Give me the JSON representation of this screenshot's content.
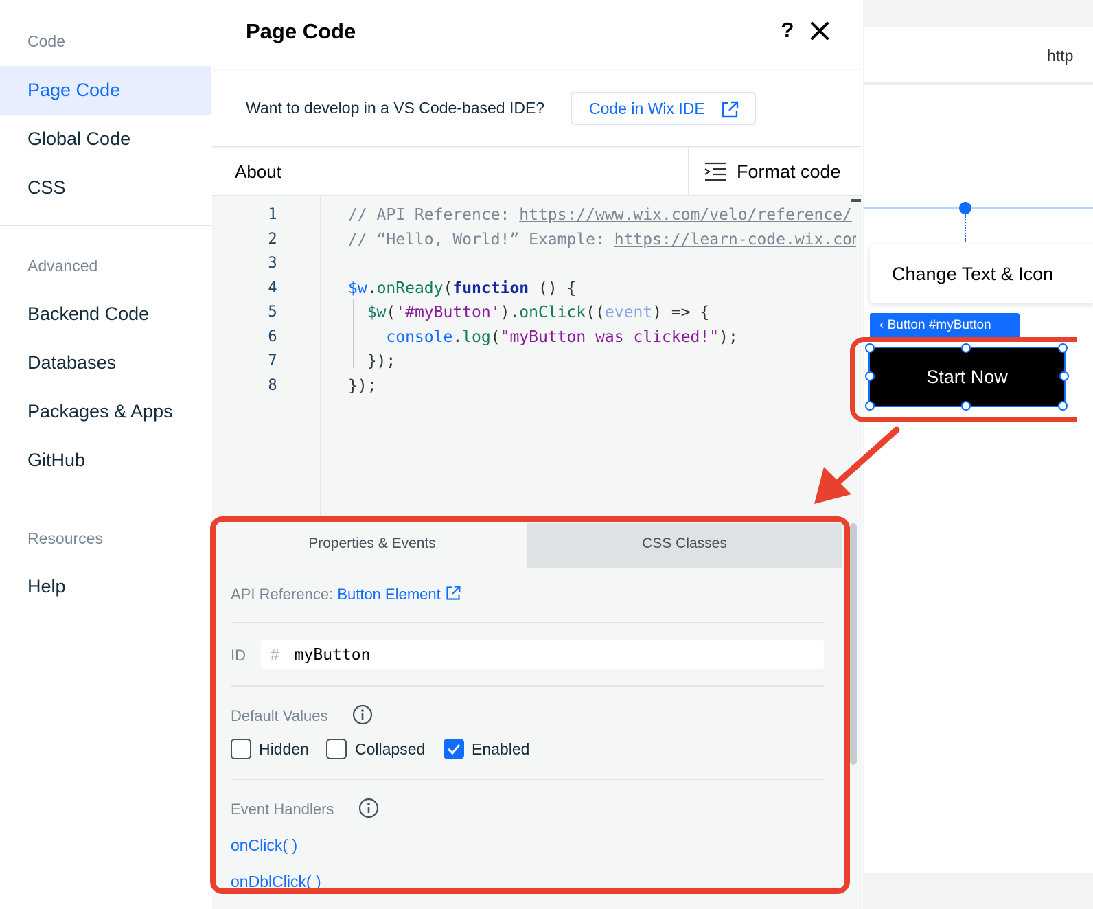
{
  "sidebar": {
    "code_heading": "Code",
    "code_items": [
      {
        "label": "Page Code",
        "active": true
      },
      {
        "label": "Global Code",
        "active": false
      },
      {
        "label": "CSS",
        "active": false
      }
    ],
    "advanced_heading": "Advanced",
    "advanced_items": [
      {
        "label": "Backend Code"
      },
      {
        "label": "Databases"
      },
      {
        "label": "Packages & Apps"
      },
      {
        "label": "GitHub"
      }
    ],
    "resources_heading": "Resources",
    "resources_items": [
      {
        "label": "Help"
      }
    ]
  },
  "panel": {
    "title": "Page Code",
    "help_label": "?",
    "ide_prompt": "Want to develop in a VS Code-based IDE?",
    "ide_button": "Code in Wix IDE",
    "about_tab": "About",
    "format_button": "Format code"
  },
  "editor": {
    "line_numbers": [
      "1",
      "2",
      "3",
      "4",
      "5",
      "6",
      "7",
      "8"
    ],
    "lines": [
      [
        {
          "t": "// API Reference: ",
          "c": "c-comment"
        },
        {
          "t": "https://www.wix.com/velo/reference/",
          "c": "c-link"
        }
      ],
      [
        {
          "t": "// “Hello, World!” Example: ",
          "c": "c-comment"
        },
        {
          "t": "https://learn-code.wix.com",
          "c": "c-link"
        }
      ],
      [],
      [
        {
          "t": "$w",
          "c": "c-var"
        },
        {
          "t": ".",
          "c": "c-plain"
        },
        {
          "t": "onReady",
          "c": "c-fn"
        },
        {
          "t": "(",
          "c": "c-plain"
        },
        {
          "t": "function",
          "c": "c-kw"
        },
        {
          "t": " () {",
          "c": "c-plain"
        }
      ],
      [
        {
          "t": "  ",
          "c": "c-plain"
        },
        {
          "t": "$w",
          "c": "c-fn"
        },
        {
          "t": "(",
          "c": "c-plain"
        },
        {
          "t": "'#myButton'",
          "c": "c-str"
        },
        {
          "t": ").",
          "c": "c-plain"
        },
        {
          "t": "onClick",
          "c": "c-fn"
        },
        {
          "t": "((",
          "c": "c-plain"
        },
        {
          "t": "event",
          "c": "c-param"
        },
        {
          "t": ") => {",
          "c": "c-plain"
        }
      ],
      [
        {
          "t": "    ",
          "c": "c-plain"
        },
        {
          "t": "console",
          "c": "c-var"
        },
        {
          "t": ".",
          "c": "c-plain"
        },
        {
          "t": "log",
          "c": "c-fn"
        },
        {
          "t": "(",
          "c": "c-plain"
        },
        {
          "t": "\"myButton was clicked!\"",
          "c": "c-str"
        },
        {
          "t": ");",
          "c": "c-plain"
        }
      ],
      [
        {
          "t": "  });",
          "c": "c-plain"
        }
      ],
      [
        {
          "t": "});",
          "c": "c-plain"
        }
      ]
    ]
  },
  "properties": {
    "tabs": [
      "Properties & Events",
      "CSS Classes"
    ],
    "api_prefix": "API Reference:",
    "api_link": "Button Element",
    "id_label": "ID",
    "id_hash": "#",
    "id_value": "myButton",
    "default_values_title": "Default Values",
    "checkboxes": [
      {
        "label": "Hidden",
        "checked": false
      },
      {
        "label": "Collapsed",
        "checked": false
      },
      {
        "label": "Enabled",
        "checked": true
      }
    ],
    "event_handlers_title": "Event Handlers",
    "handlers": [
      "onClick( )",
      "onDblClick( )"
    ]
  },
  "canvas": {
    "url_text": "http",
    "card_text": "Change Text & Icon",
    "selection_tag": "Button #myButton",
    "button_label": "Start Now"
  },
  "colors": {
    "accent": "#116dff",
    "annotation": "#e8412e",
    "active_bg": "#e7efff"
  }
}
